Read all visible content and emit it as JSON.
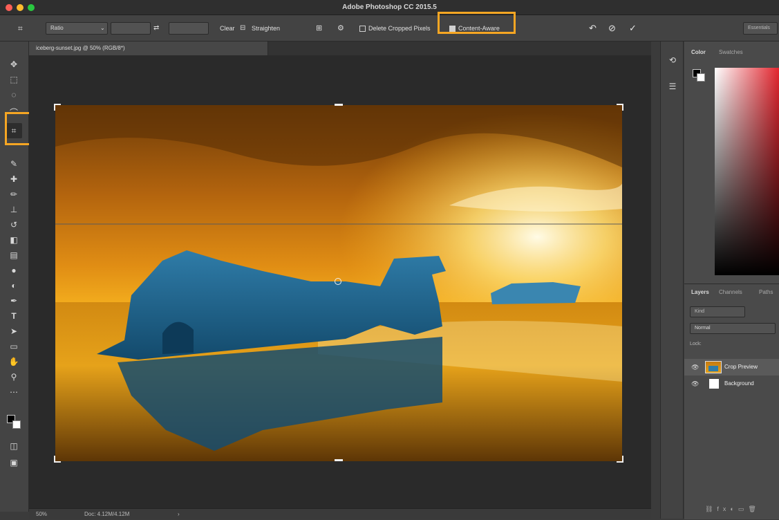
{
  "window": {
    "title": "Adobe Photoshop CC 2015.5"
  },
  "options_bar": {
    "ratio_value": "Ratio",
    "clear_label": "Clear",
    "straighten_label": "Straighten",
    "delete_cropped_label": "Delete Cropped Pixels",
    "content_aware_label": "Content-Aware",
    "workspace_label": "Essentials"
  },
  "document": {
    "tab_label": "iceberg-sunset.jpg @ 50% (RGB/8*)"
  },
  "status": {
    "zoom": "50%",
    "doc_size": "Doc: 4.12M/4.12M"
  },
  "color_panel": {
    "tabs": [
      "Color",
      "Swatches"
    ]
  },
  "layers_panel": {
    "tabs": [
      "Layers",
      "Channels",
      "Paths"
    ],
    "kind_label": "Kind",
    "blend_mode": "Normal",
    "lock_label": "Lock:",
    "layers": [
      {
        "name": "Crop Preview",
        "visible": true,
        "selected": true
      },
      {
        "name": "Background",
        "visible": true,
        "selected": false
      }
    ]
  },
  "colors": {
    "highlight": "#f6a623",
    "panel_bg": "#4a4a4a",
    "canvas_bg": "#2a2a2a"
  }
}
